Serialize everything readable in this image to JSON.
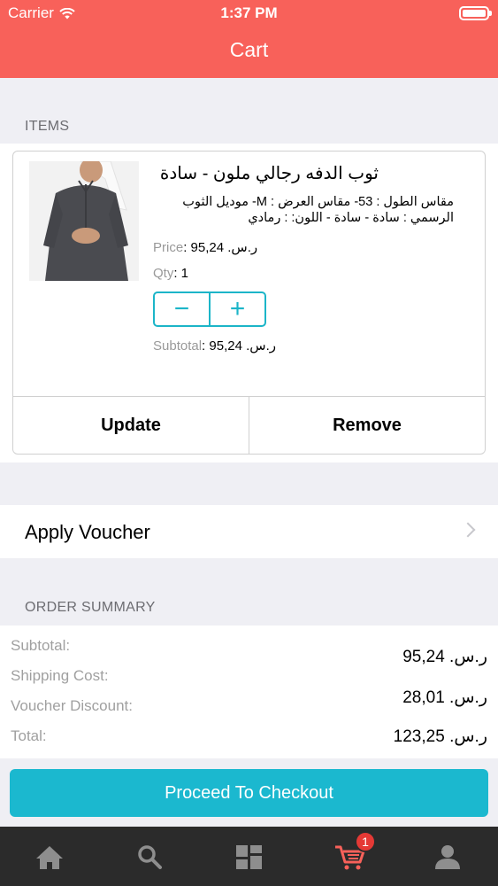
{
  "status_bar": {
    "carrier": "Carrier",
    "time": "1:37 PM"
  },
  "nav": {
    "title": "Cart"
  },
  "items_section": {
    "label": "ITEMS"
  },
  "item": {
    "name": "ثوب الدفه رجالي ملون - سادة",
    "description": "مقاس الطول : 53-  مقاس العرض : M-  موديل الثوب الرسمي : سادة - سادة - اللون: : رمادي",
    "price_label": "Price",
    "price": ": 95,24 .ر.س",
    "qty_label": "Qty",
    "qty": ": 1",
    "minus": "−",
    "plus": "+",
    "subtotal_label": "Subtotal",
    "subtotal": ": 95,24 .ر.س",
    "update_label": "Update",
    "remove_label": "Remove"
  },
  "voucher": {
    "label": "Apply Voucher"
  },
  "summary": {
    "label": "ORDER SUMMARY",
    "subtotal_label": "Subtotal:",
    "shipping_label": "Shipping Cost:",
    "discount_label": "Voucher Discount:",
    "total_label": "Total:",
    "subtotal_value": "95,24 .ر.س",
    "shipping_value": "28,01 .ر.س",
    "total_value": "123,25 .ر.س"
  },
  "checkout": {
    "label": "Proceed To Checkout"
  },
  "tabbar": {
    "cart_badge": "1"
  },
  "colors": {
    "header": "#f8615a",
    "accent": "#1bb8cf",
    "tabbar": "#2b2b2b",
    "active_tab": "#f8615a"
  },
  "icons": [
    "wifi-icon",
    "battery-icon",
    "chevron-right-icon",
    "home-icon",
    "search-icon",
    "categories-icon",
    "cart-icon",
    "profile-icon"
  ]
}
